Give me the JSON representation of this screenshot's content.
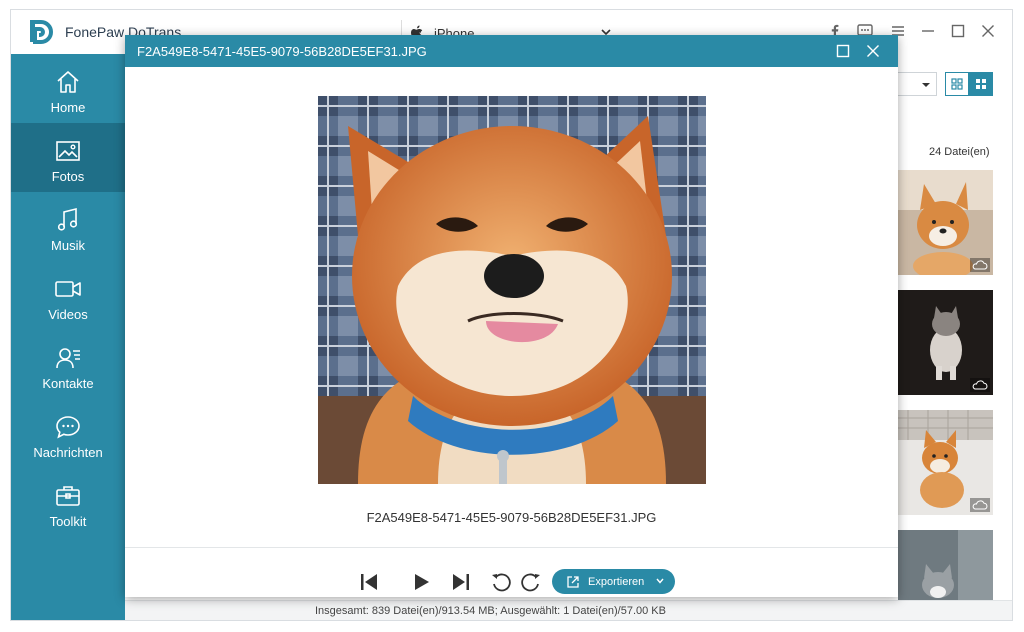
{
  "app": {
    "title": "FonePaw DoTrans",
    "device": "iPhone"
  },
  "sidebar": {
    "items": [
      {
        "label": "Home",
        "icon": "home-icon"
      },
      {
        "label": "Fotos",
        "icon": "photo-icon",
        "active": true
      },
      {
        "label": "Musik",
        "icon": "music-icon"
      },
      {
        "label": "Videos",
        "icon": "video-icon"
      },
      {
        "label": "Kontakte",
        "icon": "contacts-icon"
      },
      {
        "label": "Nachrichten",
        "icon": "messages-icon"
      },
      {
        "label": "Toolkit",
        "icon": "toolkit-icon"
      }
    ]
  },
  "gallery": {
    "file_count": "24 Datei(en)"
  },
  "status": {
    "text": "Insgesamt: 839 Datei(en)/913.54 MB; Ausgewählt: 1 Datei(en)/57.00 KB"
  },
  "viewer": {
    "title": "F2A549E8-5471-45E5-9079-56B28DE5EF31.JPG",
    "caption": "F2A549E8-5471-45E5-9079-56B28DE5EF31.JPG",
    "export_label": "Exportieren"
  },
  "colors": {
    "accent": "#2a8aa6",
    "sidebar_active": "#1f6f88"
  }
}
